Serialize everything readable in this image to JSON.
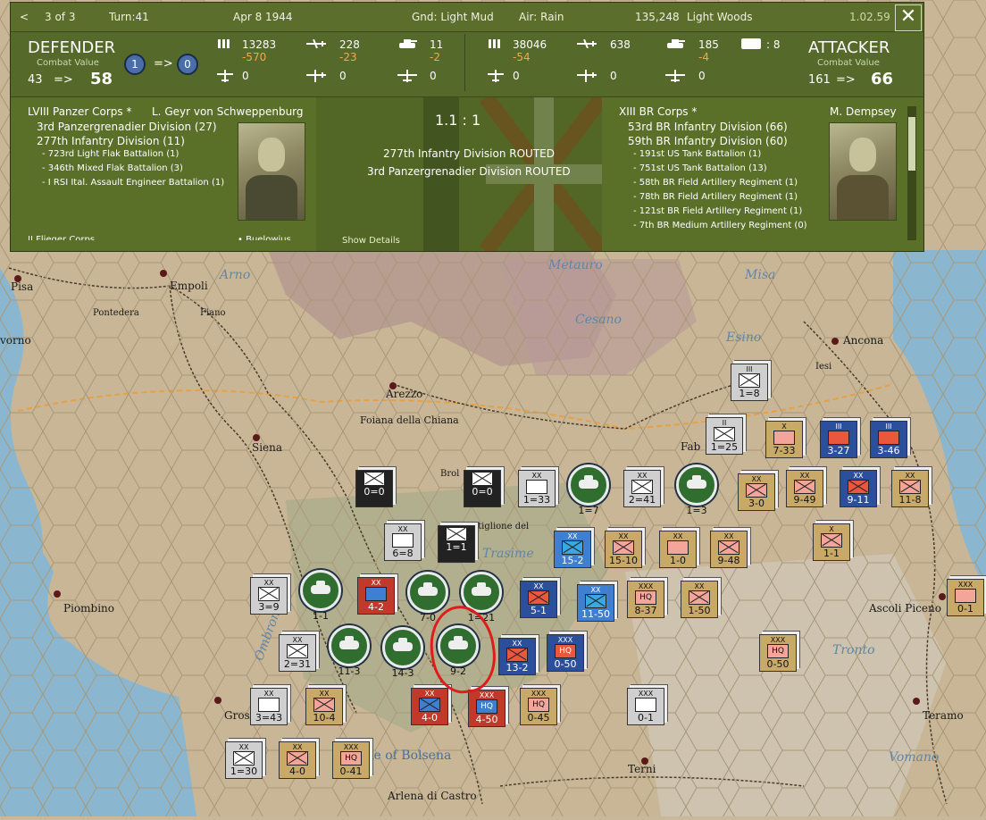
{
  "topbar": {
    "back_glyph": "<",
    "page": "3 of 3",
    "turn": "Turn:41",
    "date": "Apr 8 1944",
    "ground": "Gnd: Light Mud",
    "air": "Air: Rain",
    "hex_id": "135,248",
    "terrain": "Light Woods",
    "version": "1.02.59",
    "close_glyph": "✕"
  },
  "defender": {
    "title": "DEFENDER",
    "cv_label": "Combat Value",
    "cv_from": "43",
    "arrow": "=>",
    "cv_to": "58",
    "rounds_from": "1",
    "rounds_to": "0",
    "men": "13283",
    "men_loss": "-570",
    "air": "228",
    "air_loss": "-23",
    "tanks": "11",
    "tanks_loss": "-2",
    "row2a": "0",
    "row2b": "0",
    "row2c": "0"
  },
  "attacker": {
    "title": "ATTACKER",
    "cv_label": "Combat Value",
    "cv_from": "161",
    "arrow": "=>",
    "cv_to": "66",
    "men": "38046",
    "men_loss": "-54",
    "air": "638",
    "tanks": "185",
    "tanks_loss": "-4",
    "row2a": "0",
    "row2b": "0",
    "row2c": "0",
    "extra": ": 8"
  },
  "left_col": {
    "corps": "LVIII Panzer Corps *",
    "leader": "L. Geyr von Schweppenburg",
    "lines": [
      "3rd Panzergrenadier Division (27)",
      "277th Infantry Division (11)"
    ],
    "small_lines": [
      "- 723rd Light Flak Battalion (1)",
      "- 346th Mixed Flak Battalion (3)",
      "- I RSI Ital. Assault Engineer Battalion (1)"
    ],
    "cut_left": "II Flieger Corps",
    "cut_right": "• Buelowius"
  },
  "mid_col": {
    "odds": "1.1 : 1",
    "results": [
      "277th Infantry Division ROUTED",
      "3rd Panzergrenadier Division ROUTED"
    ],
    "show_details": "Show Details"
  },
  "right_col": {
    "corps": "XIII BR Corps *",
    "leader": "M. Dempsey",
    "lines": [
      "53rd BR Infantry Division (66)",
      "59th BR Infantry Division (60)"
    ],
    "small_lines": [
      "- 191st US Tank Battalion (1)",
      "- 751st US Tank Battalion (13)",
      "- 58th BR Field Artillery Regiment (1)",
      "- 78th BR Field Artillery Regiment (1)",
      "- 121st BR Field Artillery Regiment (1)",
      "- 7th BR Medium Artillery Regiment (0)"
    ]
  },
  "map": {
    "cities": [
      "Pisa",
      "Empoli",
      "Pontedera",
      "Fiano",
      "Arezzo",
      "Siena",
      "Foiana della Chiana",
      "Brol",
      "stiglione del",
      "Piombino",
      "Gros",
      "Terni",
      "Ancona",
      "Iesi",
      "Fab",
      "Ascoli Piceno",
      "Teramo",
      "Arlena di Castro",
      "vorno",
      "ke of Bolsena"
    ],
    "rivers": [
      "Arno",
      "Metauro",
      "Cesano",
      "Esino",
      "Misa",
      "Trasime",
      "Ombrone",
      "Tronto",
      "Vomano"
    ],
    "units": [
      {
        "size": "III",
        "str": "1=8",
        "style": "gray"
      },
      {
        "size": "II",
        "str": "1=25",
        "style": "gray"
      },
      {
        "size": "X",
        "str": "7-33",
        "style": "tan"
      },
      {
        "size": "III",
        "str": "3-27",
        "style": "blue"
      },
      {
        "size": "III",
        "str": "3-46",
        "style": "blue"
      },
      {
        "size": "",
        "str": "0=0",
        "style": "ss"
      },
      {
        "size": "",
        "str": "0=0",
        "style": "ss"
      },
      {
        "size": "XX",
        "str": "1=33",
        "style": "gray"
      },
      {
        "size": "",
        "str": "1=7",
        "style": "tank"
      },
      {
        "size": "XX",
        "str": "2=41",
        "style": "gray"
      },
      {
        "size": "",
        "str": "1=3",
        "style": "tank"
      },
      {
        "size": "XX",
        "str": "3-0",
        "style": "tan"
      },
      {
        "size": "XX",
        "str": "9-49",
        "style": "tan"
      },
      {
        "size": "XX",
        "str": "9-11",
        "style": "blue"
      },
      {
        "size": "XX",
        "str": "11-8",
        "style": "tan"
      },
      {
        "size": "XX",
        "str": "6=8",
        "style": "gray"
      },
      {
        "size": "",
        "str": "1=1",
        "style": "ss"
      },
      {
        "size": "XX",
        "str": "15-2",
        "style": "lblue"
      },
      {
        "size": "XX",
        "str": "15-10",
        "style": "tan"
      },
      {
        "size": "XX",
        "str": "1-0",
        "style": "tan"
      },
      {
        "size": "XX",
        "str": "9-48",
        "style": "tan"
      },
      {
        "size": "X",
        "str": "1-1",
        "style": "tan"
      },
      {
        "size": "XX",
        "str": "3=9",
        "style": "gray"
      },
      {
        "size": "",
        "str": "1-1",
        "style": "tank"
      },
      {
        "size": "XX",
        "str": "4-2",
        "style": "red"
      },
      {
        "size": "",
        "str": "7-0",
        "style": "tank"
      },
      {
        "size": "",
        "str": "1=21",
        "style": "tank"
      },
      {
        "size": "XX",
        "str": "5-1",
        "style": "blue"
      },
      {
        "size": "XX",
        "str": "11-50",
        "style": "lblue"
      },
      {
        "size": "XXX",
        "str": "8-37",
        "style": "tan"
      },
      {
        "size": "XX",
        "str": "1-50",
        "style": "tan"
      },
      {
        "size": "XXX",
        "str": "0-1",
        "style": "tan"
      },
      {
        "size": "XX",
        "str": "2=31",
        "style": "gray"
      },
      {
        "size": "",
        "str": "11-3",
        "style": "tank"
      },
      {
        "size": "",
        "str": "14-3",
        "style": "tank"
      },
      {
        "size": "",
        "str": "9-2",
        "style": "tank"
      },
      {
        "size": "XX",
        "str": "13-2",
        "style": "blue"
      },
      {
        "size": "XXX",
        "str": "0-50",
        "style": "blue"
      },
      {
        "size": "XXX",
        "str": "0-50",
        "style": "tan"
      },
      {
        "size": "XX",
        "str": "3=43",
        "style": "gray"
      },
      {
        "size": "XX",
        "str": "10-4",
        "style": "tan"
      },
      {
        "size": "XX",
        "str": "4-0",
        "style": "red"
      },
      {
        "size": "XXX",
        "str": "4-50",
        "style": "red"
      },
      {
        "size": "XXX",
        "str": "0-45",
        "style": "tan"
      },
      {
        "size": "XXX",
        "str": "0-1",
        "style": "gray"
      },
      {
        "size": "XX",
        "str": "1=30",
        "style": "gray"
      },
      {
        "size": "XX",
        "str": "4-0",
        "style": "tan"
      },
      {
        "size": "XXX",
        "str": "0-41",
        "style": "tan"
      }
    ],
    "hq_label": "HQ"
  },
  "colors": {
    "panel": "#5a6e2a",
    "loss": "#f3a94a",
    "highlight": "#e01b1b"
  }
}
